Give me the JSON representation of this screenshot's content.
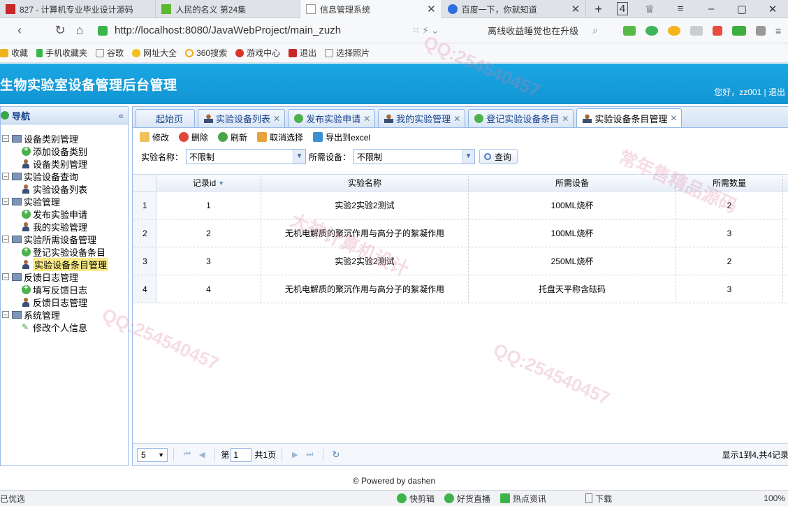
{
  "browser": {
    "tabs": [
      {
        "label": "827 - 计算机专业毕业设计源码",
        "active": false
      },
      {
        "label": "人民的名义 第24集",
        "active": false
      },
      {
        "label": "信息管理系统",
        "active": true
      },
      {
        "label": "百度一下，你就知道",
        "active": false
      }
    ],
    "new_tab": "+",
    "tab_count": "4",
    "url": "http://localhost:8080/JavaWebProject/main_zuzh",
    "search_hint": "离线收益睡觉也在升级",
    "bookmarks": [
      "收藏",
      "手机收藏夹",
      "谷歌",
      "网址大全",
      "360搜索",
      "游戏中心",
      "退出",
      "选择照片"
    ]
  },
  "app": {
    "title": "生物实验室设备管理后台管理",
    "user_text": "您好，zz001 | 退出"
  },
  "leftnav": {
    "title": "导航",
    "collapse": "«",
    "tree": [
      {
        "label": "设备类别管理",
        "level": 0
      },
      {
        "label": "添加设备类别",
        "level": 1,
        "icon": "add"
      },
      {
        "label": "设备类别管理",
        "level": 1,
        "icon": "person"
      },
      {
        "label": "实验设备查询",
        "level": 0
      },
      {
        "label": "实验设备列表",
        "level": 1,
        "icon": "person"
      },
      {
        "label": "实验管理",
        "level": 0
      },
      {
        "label": "发布实验申请",
        "level": 1,
        "icon": "add"
      },
      {
        "label": "我的实验管理",
        "level": 1,
        "icon": "person"
      },
      {
        "label": "实验所需设备管理",
        "level": 0
      },
      {
        "label": "登记实验设备条目",
        "level": 1,
        "icon": "add"
      },
      {
        "label": "实验设备条目管理",
        "level": 1,
        "icon": "person",
        "selected": true
      },
      {
        "label": "反馈日志管理",
        "level": 0
      },
      {
        "label": "填写反馈日志",
        "level": 1,
        "icon": "add"
      },
      {
        "label": "反馈日志管理",
        "level": 1,
        "icon": "person"
      },
      {
        "label": "系统管理",
        "level": 0
      },
      {
        "label": "修改个人信息",
        "level": 1,
        "icon": "pen"
      }
    ]
  },
  "main": {
    "tabs": [
      {
        "label": "起始页",
        "icon": "none",
        "closable": false
      },
      {
        "label": "实验设备列表",
        "icon": "person",
        "closable": true
      },
      {
        "label": "发布实验申请",
        "icon": "add",
        "closable": true
      },
      {
        "label": "我的实验管理",
        "icon": "person",
        "closable": true
      },
      {
        "label": "登记实验设备条目",
        "icon": "add",
        "closable": true
      },
      {
        "label": "实验设备条目管理",
        "icon": "person",
        "closable": true,
        "active": true
      }
    ],
    "toolbar": {
      "edit": "修改",
      "delete": "删除",
      "refresh": "刷新",
      "cancel_select": "取消选择",
      "export": "导出到excel"
    },
    "filter": {
      "exp_label": "实验名称：",
      "exp_value": "不限制",
      "device_label": "所需设备：",
      "device_value": "不限制",
      "query": "查询"
    },
    "grid": {
      "columns": [
        "记录id",
        "实验名称",
        "所需设备",
        "所需数量"
      ],
      "rows": [
        {
          "rownum": "1",
          "id": "1",
          "exp": "实验2实验2测试",
          "device": "100ML烧杯",
          "qty": "2"
        },
        {
          "rownum": "2",
          "id": "2",
          "exp": "无机电解质的聚沉作用与高分子的絮凝作用",
          "device": "100ML烧杯",
          "qty": "3"
        },
        {
          "rownum": "3",
          "id": "3",
          "exp": "实验2实验2测试",
          "device": "250ML烧杯",
          "qty": "2"
        },
        {
          "rownum": "4",
          "id": "4",
          "exp": "无机电解质的聚沉作用与高分子的絮凝作用",
          "device": "托盘天平称含砝码",
          "qty": "3"
        }
      ]
    },
    "pager": {
      "page_size": "5",
      "page_prefix": "第",
      "page_value": "1",
      "page_total": "共1页",
      "info": "显示1到4,共4记录"
    }
  },
  "footer": {
    "text": "© Powered by dashen"
  },
  "statusbar": {
    "left": "已优选",
    "items": [
      "快剪辑",
      "好货直播",
      "热点资讯",
      "下载"
    ],
    "zoom": "100%"
  },
  "watermark": {
    "lines": [
      "QQ:254540457",
      "常年售精品源码",
      "大神计算机设计"
    ]
  }
}
